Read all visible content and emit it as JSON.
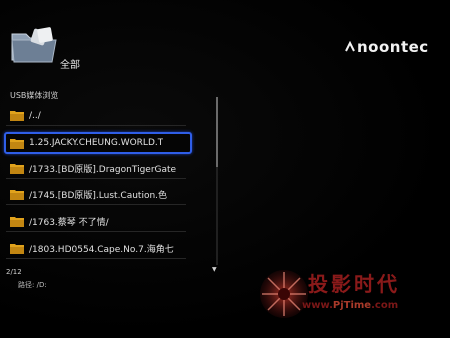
{
  "header": {
    "title": "全部"
  },
  "brand": {
    "name": "noontec"
  },
  "browser": {
    "source_label": "USB媒体浏览",
    "items": [
      {
        "label": "/../",
        "selected": false
      },
      {
        "label": "1.25.JACKY.CHEUNG.WORLD.T",
        "selected": true
      },
      {
        "label": "/1733.[BD原版].DragonTigerGate",
        "selected": false
      },
      {
        "label": "/1745.[BD原版].Lust.Caution.色",
        "selected": false
      },
      {
        "label": "/1763.蔡琴 不了情/",
        "selected": false
      },
      {
        "label": "/1803.HD0554.Cape.No.7.海角七",
        "selected": false
      }
    ],
    "page_count": "2/12",
    "path": "路径: /D:",
    "scroll_arrow": "▼"
  },
  "watermark": {
    "title": "投影时代",
    "url_prefix": "www.",
    "url_brand": "PjTime",
    "url_suffix": ".com"
  },
  "colors": {
    "selection_border": "#2f5ee8",
    "folder": "#e0a21c",
    "watermark": "#8a1a1a"
  },
  "icons": {
    "folder": "folder-icon",
    "header_folder": "folder-large-icon",
    "brand": "noontec-logo-icon"
  }
}
